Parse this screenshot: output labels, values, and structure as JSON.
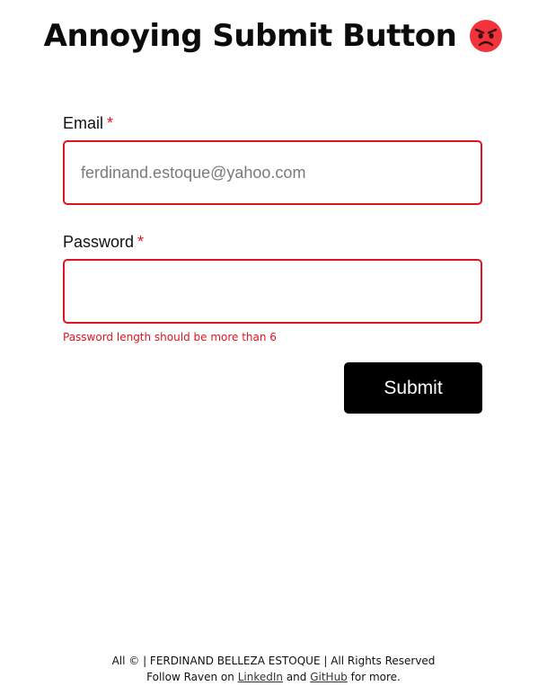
{
  "header": {
    "title": "Annoying Submit Button",
    "emoji_icon": "angry-face-icon",
    "emoji_color": "#f2333b"
  },
  "form": {
    "email": {
      "label": "Email",
      "required_mark": "*",
      "value": "",
      "placeholder": "ferdinand.estoque@yahoo.com"
    },
    "password": {
      "label": "Password",
      "required_mark": "*",
      "value": "",
      "placeholder": "",
      "error": "Password length should be more than 6"
    },
    "submit_label": "Submit"
  },
  "footer": {
    "line1": "All ©  | FERDINAND BELLEZA ESTOQUE | All Rights Reserved",
    "follow_prefix": "Follow Raven on ",
    "linkedin": "LinkedIn",
    "and": " and ",
    "github": "GitHub",
    "suffix": " for more."
  },
  "colors": {
    "error_red": "#e0141e",
    "button_bg": "#000000",
    "button_text": "#ffffff"
  }
}
